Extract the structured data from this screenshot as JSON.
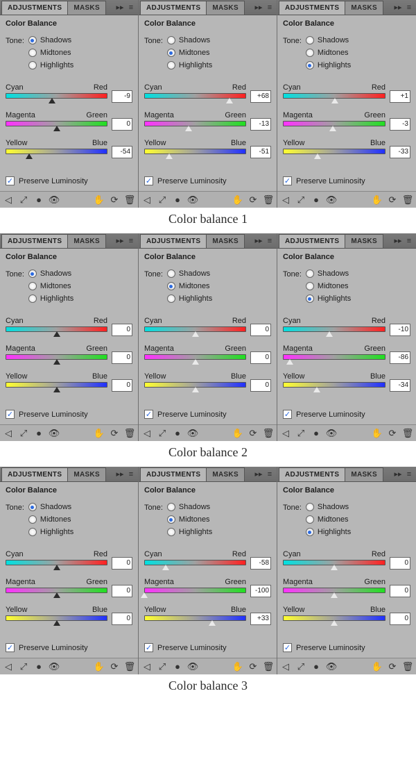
{
  "tabs": {
    "adjustments": "ADJUSTMENTS",
    "masks": "MASKS"
  },
  "panel_title": "Color Balance",
  "tone": {
    "label": "Tone:",
    "shadows": "Shadows",
    "midtones": "Midtones",
    "highlights": "Highlights"
  },
  "slider_labels": {
    "cyan": "Cyan",
    "red": "Red",
    "magenta": "Magenta",
    "green": "Green",
    "yellow": "Yellow",
    "blue": "Blue"
  },
  "preserve_label": "Preserve Luminosity",
  "captions": {
    "g1": "Color balance 1",
    "g2": "Color balance 2",
    "g3": "Color balance 3"
  },
  "groups": [
    {
      "panels": [
        {
          "selected": "shadows",
          "hollow_thumb": false,
          "cr": -9,
          "mg": 0,
          "yb": -54
        },
        {
          "selected": "midtones",
          "hollow_thumb": true,
          "cr": 68,
          "mg": -13,
          "yb": -51
        },
        {
          "selected": "highlights",
          "hollow_thumb": true,
          "cr": 1,
          "mg": -3,
          "yb": -33
        }
      ]
    },
    {
      "panels": [
        {
          "selected": "shadows",
          "hollow_thumb": false,
          "cr": 0,
          "mg": 0,
          "yb": 0
        },
        {
          "selected": "midtones",
          "hollow_thumb": true,
          "cr": 0,
          "mg": 0,
          "yb": 0
        },
        {
          "selected": "highlights",
          "hollow_thumb": true,
          "cr": -10,
          "mg": -86,
          "yb": -34
        }
      ]
    },
    {
      "panels": [
        {
          "selected": "shadows",
          "hollow_thumb": false,
          "cr": 0,
          "mg": 0,
          "yb": 0
        },
        {
          "selected": "midtones",
          "hollow_thumb": true,
          "cr": -58,
          "mg": -100,
          "yb": 33
        },
        {
          "selected": "highlights",
          "hollow_thumb": true,
          "cr": 0,
          "mg": 0,
          "yb": 0
        }
      ]
    }
  ],
  "chart_data": [
    {
      "type": "table",
      "title": "Color balance 1",
      "categories": [
        "Cyan-Red",
        "Magenta-Green",
        "Yellow-Blue"
      ],
      "series": [
        {
          "name": "Shadows",
          "values": [
            -9,
            0,
            -54
          ]
        },
        {
          "name": "Midtones",
          "values": [
            68,
            -13,
            -51
          ]
        },
        {
          "name": "Highlights",
          "values": [
            1,
            -3,
            -33
          ]
        }
      ],
      "range": [
        -100,
        100
      ]
    },
    {
      "type": "table",
      "title": "Color balance 2",
      "categories": [
        "Cyan-Red",
        "Magenta-Green",
        "Yellow-Blue"
      ],
      "series": [
        {
          "name": "Shadows",
          "values": [
            0,
            0,
            0
          ]
        },
        {
          "name": "Midtones",
          "values": [
            0,
            0,
            0
          ]
        },
        {
          "name": "Highlights",
          "values": [
            -10,
            -86,
            -34
          ]
        }
      ],
      "range": [
        -100,
        100
      ]
    },
    {
      "type": "table",
      "title": "Color balance 3",
      "categories": [
        "Cyan-Red",
        "Magenta-Green",
        "Yellow-Blue"
      ],
      "series": [
        {
          "name": "Shadows",
          "values": [
            0,
            0,
            0
          ]
        },
        {
          "name": "Midtones",
          "values": [
            -58,
            -100,
            33
          ]
        },
        {
          "name": "Highlights",
          "values": [
            0,
            0,
            0
          ]
        }
      ],
      "range": [
        -100,
        100
      ]
    }
  ]
}
